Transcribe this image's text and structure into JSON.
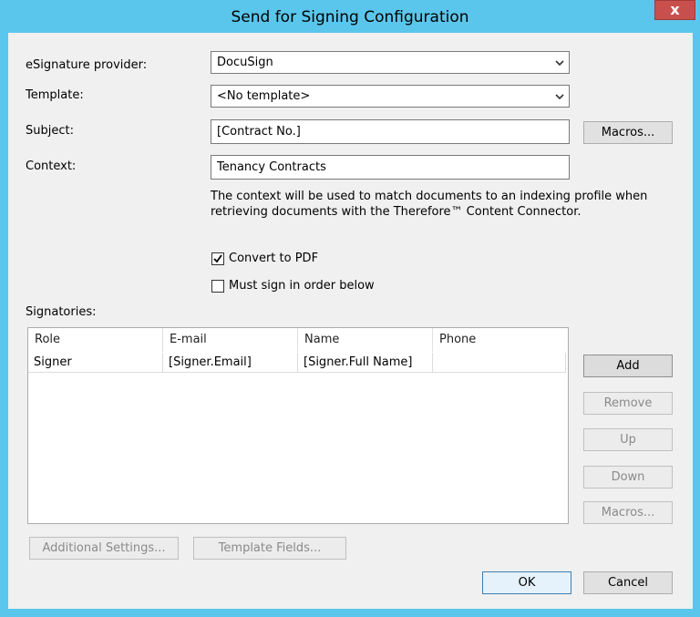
{
  "window": {
    "title": "Send for Signing Configuration",
    "close_glyph": "x"
  },
  "form": {
    "provider_label": "eSignature provider:",
    "provider_value": "DocuSign",
    "template_label": "Template:",
    "template_value": "<No template>",
    "subject_label": "Subject:",
    "subject_value": "[Contract No.]",
    "macros_label": "Macros...",
    "context_label": "Context:",
    "context_value": "Tenancy Contracts",
    "context_note_1": "The context will be used to match documents to an indexing profile when",
    "context_note_2": "retrieving documents with the Therefore™ Content Connector.",
    "convert_pdf_label": "Convert to PDF",
    "convert_pdf_checked": true,
    "sign_order_label": "Must sign in order below",
    "sign_order_checked": false
  },
  "signatories": {
    "label": "Signatories:",
    "columns": [
      "Role",
      "E-mail",
      "Name",
      "Phone"
    ],
    "rows": [
      [
        "Signer",
        "[Signer.Email]",
        "[Signer.Full Name]",
        ""
      ]
    ]
  },
  "side_buttons": {
    "add": "Add",
    "remove": "Remove",
    "up": "Up",
    "down": "Down",
    "macros": "Macros..."
  },
  "bottom": {
    "additional_settings": "Additional Settings...",
    "template_fields": "Template Fields...",
    "ok": "OK",
    "cancel": "Cancel"
  },
  "colors": {
    "title_bar": "#5bc6eb",
    "close_button": "#c7504d",
    "dialog_bg": "#f0f0f0"
  },
  "icons": {
    "close": "close-icon",
    "dropdown": "chevron-down-icon",
    "check": "check-icon"
  }
}
